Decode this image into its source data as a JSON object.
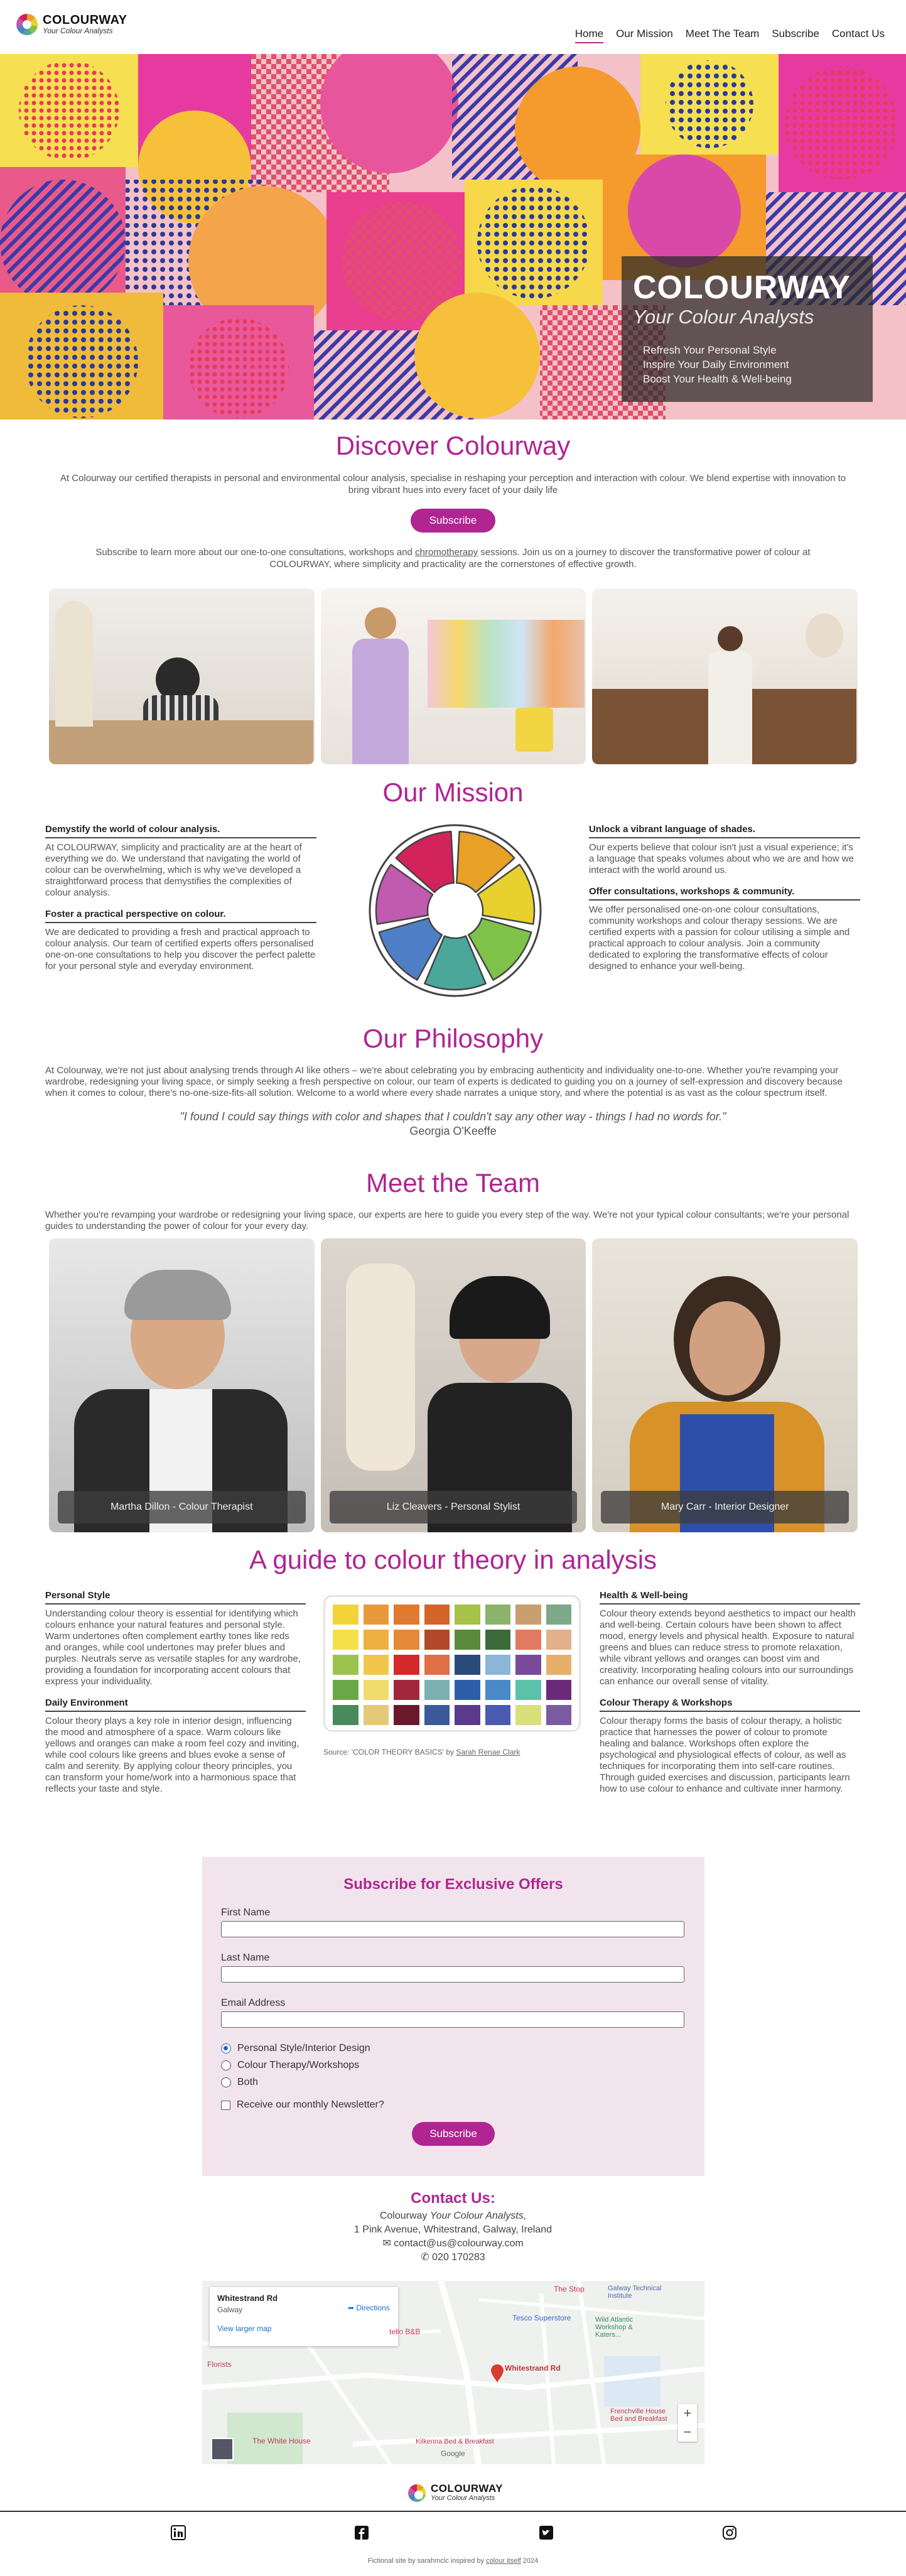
{
  "brand": {
    "name": "COLOURWAY",
    "tagline": "Your Colour Analysts"
  },
  "nav": [
    "Home",
    "Our Mission",
    "Meet The Team",
    "Subscribe",
    "Contact Us"
  ],
  "hero": {
    "title": "COLOURWAY",
    "subtitle": "Your Colour Analysts",
    "lines": [
      "Refresh Your Personal Style",
      "Inspire Your Daily Environment",
      "Boost Your Health & Well-being"
    ]
  },
  "discover": {
    "title": "Discover Colourway",
    "intro": "At Colourway our certified therapists in personal and environmental colour analysis, specialise in reshaping your perception and interaction with colour. We blend expertise with innovation to bring vibrant hues into every facet of your daily life",
    "button": "Subscribe",
    "outro_before": "Subscribe to learn more about our one-to-one consultations, workshops and ",
    "outro_link": "chromotherapy",
    "outro_after": " sessions. Join us on a journey to discover the transformative power of colour at COLOURWAY, where simplicity and practicality are the cornerstones of effective growth."
  },
  "mission": {
    "title": "Our Mission",
    "blocks": [
      {
        "head": "Demystify the world of colour analysis.",
        "text": "At COLOURWAY, simplicity and practicality are at the heart of everything we do. We understand that navigating the world of colour can be overwhelming, which is why we've developed a straightforward process that demystifies the complexities of colour analysis."
      },
      {
        "head": "Foster a practical perspective on colour.",
        "text": "We are dedicated to providing a fresh and practical approach to colour analysis. Our team of certified experts offers personalised one-on-one consultations to help you discover the perfect palette for your personal style and everyday environment."
      },
      {
        "head": "Unlock a vibrant language of shades.",
        "text": "Our experts believe that colour isn't just a visual experience; it's a language that speaks volumes about who we are and how we interact with the world around us."
      },
      {
        "head": "Offer consultations, workshops & community.",
        "text": "We offer personalised one-on-one colour consultations, community workshops and colour therapy sessions. We are certified experts with a passion for colour utilising a simple and practical approach to colour analysis. Join a community dedicated to exploring the transformative effects of colour designed to enhance your well-being."
      }
    ],
    "wheel_colors": [
      "#e8a126",
      "#e8d12f",
      "#7ec24a",
      "#4aa79a",
      "#4e7fc6",
      "#c05bb0",
      "#d2235c"
    ]
  },
  "philosophy": {
    "title": "Our Philosophy",
    "text": "At Colourway, we're not just about analysing trends through AI like others – we're about celebrating you by embracing authenticity and individuality one-to-one. Whether you're revamping your wardrobe, redesigning your living space, or simply seeking a fresh perspective on colour, our team of experts is dedicated to guiding you on a journey of self-expression and discovery because when it comes to colour, there's no-one-size-fits-all solution. Welcome to a world where every shade narrates a unique story, and where the potential is as vast as the colour spectrum itself.",
    "quote": "\"I found I could say things with color and shapes that I couldn't say any other way - things I had no words for.\"",
    "author": "Georgia O'Keeffe"
  },
  "team": {
    "title": "Meet the Team",
    "intro": "Whether you're revamping your wardrobe or redesigning your living space, our experts are here to guide you every step of the way. We're not your typical colour consultants; we're your personal guides to understanding the power of colour for your every day.",
    "members": [
      "Martha Dillon - Colour Therapist",
      "Liz Cleavers - Personal Stylist",
      "Mary Carr - Interior Designer"
    ]
  },
  "guide": {
    "title": "A guide to colour theory in analysis",
    "blocks": [
      {
        "head": "Personal Style",
        "text": "Understanding colour theory is essential for identifying which colours enhance your natural features and personal style. Warm undertones often complement earthy tones like reds and oranges, while cool undertones may prefer blues and purples. Neutrals serve as versatile staples for any wardrobe, providing a foundation for incorporating accent colours that express your individuality."
      },
      {
        "head": "Daily Environment",
        "text": "Colour theory plays a key role in interior design, influencing the mood and atmosphere of a space. Warm colours like yellows and oranges can make a room feel cozy and inviting, while cool colours like greens and blues evoke a sense of calm and serenity. By applying colour theory principles, you can transform your home/work into a harmonious space that reflects your taste and style."
      },
      {
        "head": "Health & Well-being",
        "text": "Colour theory extends beyond aesthetics to impact our health and well-being. Certain colours have been shown to affect mood, energy levels and physical health. Exposure to natural greens and blues can reduce stress to promote relaxation, while vibrant yellows and oranges can boost vim and creativity. Incorporating healing colours into our surroundings can enhance our overall sense of vitality."
      },
      {
        "head": "Colour Therapy & Workshops",
        "text": "Colour therapy forms the basis of colour therapy, a holistic practice that harnesses the power of colour to promote healing and balance. Workshops often explore the psychological and physiological effects of colour, as well as techniques for incorporating them into self-care routines. Through guided exercises and discussion, participants learn how to use colour to enhance and cultivate inner harmony."
      }
    ],
    "source_prefix": "Source: 'COLOR THEORY BASICS' by ",
    "source_link": "Sarah Renae Clark",
    "swatches": [
      [
        "#f2d43a",
        "#e89a3a",
        "#e07a30",
        "#d5642a",
        "#a6c24a",
        "#8bb36a",
        "#c8a070",
        "#7da88a"
      ],
      [
        "#f5e04a",
        "#f0b040",
        "#e58838",
        "#b24a2a",
        "#5a8a3a",
        "#3c6a3a",
        "#e07a60",
        "#e2b08a"
      ],
      [
        "#9ec24e",
        "#f2c64c",
        "#d42a2a",
        "#e07046",
        "#2a4a7a",
        "#8ab6d8",
        "#7a4a9a",
        "#e7b06a"
      ],
      [
        "#6aa84a",
        "#f0dc6a",
        "#a0283a",
        "#7ab0b0",
        "#2e5ea8",
        "#4a8ac6",
        "#5ac2a8",
        "#6a2a7a"
      ],
      [
        "#4a8a5a",
        "#e6c87a",
        "#6a1a2a",
        "#3a5a9a",
        "#5a3a8a",
        "#4a5ab0",
        "#d8e07a",
        "#7a5aa0"
      ]
    ]
  },
  "subscribe": {
    "title": "Subscribe for Exclusive Offers",
    "first": "First Name",
    "last": "Last Name",
    "email": "Email Address",
    "options": [
      "Personal Style/Interior Design",
      "Colour Therapy/Workshops",
      "Both"
    ],
    "newsletter": "Receive our monthly Newsletter?",
    "button": "Subscribe"
  },
  "contact": {
    "title": "Contact Us:",
    "company_prefix": "Colourway ",
    "company_italic": "Your Colour Analysts,",
    "address": "1 Pink Avenue, Whitestrand, Galway, Ireland",
    "email": "contact@us@colourway.com",
    "phone": "020 170283"
  },
  "map": {
    "place": "Whitestrand Rd",
    "region": "Galway",
    "larger": "View larger map",
    "directions": "Directions",
    "labels": [
      "The Stop",
      "Galway Technical Institute",
      "Tesco Superstore",
      "Wild Atlantic Workshop & Katers...",
      "Whitestrand Rd",
      "Frenchville House Bed and Breakfast",
      "The White House",
      "Kilkenna Bed & Breakfast",
      "Google",
      "Florists",
      "tello B&B"
    ]
  },
  "footer": {
    "credit_before": "Fictional site by sarahmclc inspired by ",
    "credit_link": "colour itself",
    "credit_after": " 2024"
  }
}
